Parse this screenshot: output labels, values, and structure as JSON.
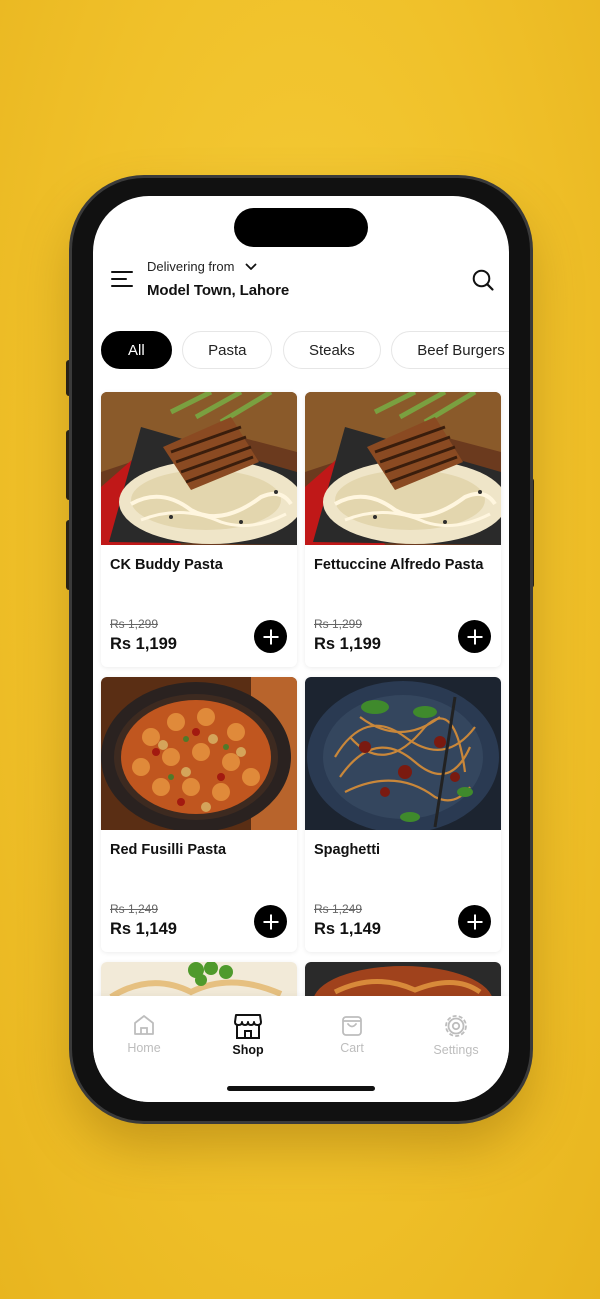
{
  "header": {
    "delivering_label": "Delivering from",
    "location": "Model Town, Lahore"
  },
  "categories": [
    {
      "label": "All",
      "active": true
    },
    {
      "label": "Pasta",
      "active": false
    },
    {
      "label": "Steaks",
      "active": false
    },
    {
      "label": "Beef Burgers",
      "active": false
    }
  ],
  "products": [
    {
      "name": "CK Buddy Pasta",
      "old_price": "Rs 1,299",
      "price": "Rs 1,199"
    },
    {
      "name": "Fettuccine Alfredo Pasta",
      "old_price": "Rs 1,299",
      "price": "Rs 1,199"
    },
    {
      "name": "Red Fusilli Pasta",
      "old_price": "Rs 1,249",
      "price": "Rs 1,149"
    },
    {
      "name": "Spaghetti",
      "old_price": "Rs 1,249",
      "price": "Rs 1,149"
    }
  ],
  "tabs": [
    {
      "label": "Home",
      "icon": "home-icon"
    },
    {
      "label": "Shop",
      "icon": "shop-icon"
    },
    {
      "label": "Cart",
      "icon": "cart-icon"
    },
    {
      "label": "Settings",
      "icon": "gear-icon"
    }
  ],
  "colors": {
    "background": "#f0c12a",
    "accent": "#000000",
    "inactive_tab": "#bdbdbd"
  }
}
